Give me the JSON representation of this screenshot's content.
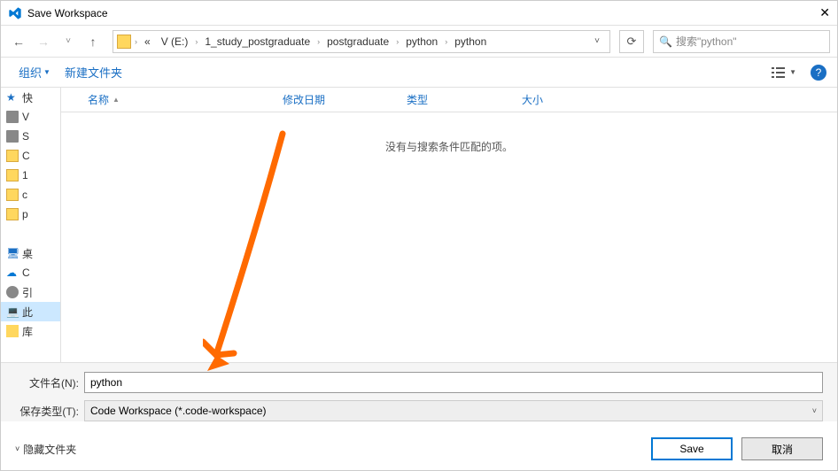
{
  "titlebar": {
    "title": "Save Workspace"
  },
  "breadcrumb": {
    "items": [
      "V (E:)",
      "1_study_postgraduate",
      "postgraduate",
      "python",
      "python"
    ]
  },
  "search": {
    "placeholder": "搜索\"python\""
  },
  "toolbar": {
    "organize": "组织",
    "newfolder": "新建文件夹"
  },
  "columns": {
    "name": "名称",
    "date": "修改日期",
    "type": "类型",
    "size": "大小"
  },
  "empty_msg": "没有与搜索条件匹配的项。",
  "sidebar": {
    "items": [
      {
        "label": "快",
        "type": "fav"
      },
      {
        "label": "V",
        "type": "drv"
      },
      {
        "label": "S",
        "type": "drv"
      },
      {
        "label": "C",
        "type": "fld"
      },
      {
        "label": "1",
        "type": "fld"
      },
      {
        "label": "c",
        "type": "fld"
      },
      {
        "label": "p",
        "type": "fld"
      },
      {
        "label": "",
        "type": "sep"
      },
      {
        "label": "桌",
        "type": "desk"
      },
      {
        "label": "C",
        "type": "cloud"
      },
      {
        "label": "引",
        "type": "usr"
      },
      {
        "label": "此",
        "type": "comp"
      },
      {
        "label": "库",
        "type": "lib"
      }
    ]
  },
  "filename": {
    "label": "文件名(N):",
    "value": "python"
  },
  "filetype": {
    "label": "保存类型(T):",
    "value": "Code Workspace (*.code-workspace)"
  },
  "footer": {
    "hide": "隐藏文件夹",
    "save": "Save",
    "cancel": "取消"
  }
}
